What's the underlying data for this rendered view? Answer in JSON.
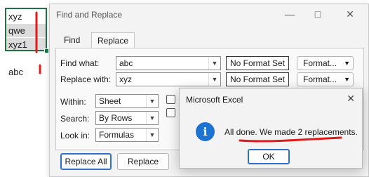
{
  "sheet": {
    "cells": [
      "xyz",
      "qwe",
      "xyz1",
      "abc"
    ]
  },
  "find_replace": {
    "title": "Find and Replace",
    "tabs": [
      "Find",
      "Replace"
    ],
    "find_label": "Find what:",
    "find_value": "abc",
    "replace_label": "Replace with:",
    "replace_value": "xyz",
    "no_format": "No Format Set",
    "format_btn": "Format...",
    "within_label": "Within:",
    "within_value": "Sheet",
    "search_label": "Search:",
    "search_value": "By Rows",
    "lookin_label": "Look in:",
    "lookin_value": "Formulas",
    "replace_all": "Replace All",
    "replace": "Replace"
  },
  "msgbox": {
    "title": "Microsoft Excel",
    "message": "All done. We made 2 replacements.",
    "ok": "OK",
    "icon": "info-icon"
  },
  "colors": {
    "accent": "#217346",
    "button_focus": "#2e6fc9",
    "annotation": "#e01b1b",
    "info": "#1e73d2"
  }
}
